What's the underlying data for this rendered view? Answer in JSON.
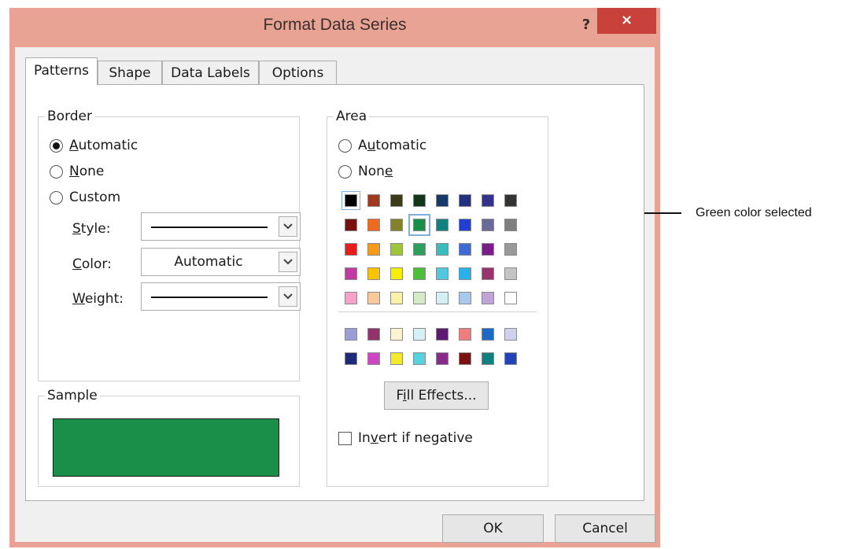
{
  "window": {
    "title": "Format Data Series",
    "help_label": "?",
    "close_label": "×"
  },
  "tabs": [
    {
      "label": "Patterns",
      "active": true
    },
    {
      "label": "Shape",
      "active": false
    },
    {
      "label": "Data Labels",
      "active": false
    },
    {
      "label": "Options",
      "active": false
    }
  ],
  "border": {
    "label": "Border",
    "options": [
      {
        "label": "Automatic",
        "accel_index": 0,
        "checked": true
      },
      {
        "label": "None",
        "accel_index": 0,
        "checked": false
      },
      {
        "label": "Custom",
        "accel_index": -1,
        "checked": false
      }
    ],
    "style_label": "Style:",
    "color_label": "Color:",
    "color_value": "Automatic",
    "weight_label": "Weight:"
  },
  "sample": {
    "label": "Sample",
    "color": "#1a8f4a"
  },
  "area": {
    "label": "Area",
    "options": [
      {
        "label": "Automatic",
        "accel_index": 1,
        "checked": false
      },
      {
        "label": "None",
        "accel_index": 3,
        "checked": false
      }
    ],
    "selected_color": "#1a8f4a",
    "palette_main": [
      [
        "#000000",
        "#a0391f",
        "#3b3b16",
        "#14371b",
        "#163a6a",
        "#23317f",
        "#33338f",
        "#333333"
      ],
      [
        "#7a1010",
        "#ef6a1c",
        "#838329",
        "#1a8f4a",
        "#108080",
        "#2140d0",
        "#6a6a9a",
        "#7f7f7f"
      ],
      [
        "#e81c1c",
        "#f69a1a",
        "#9fc53a",
        "#2e9e5d",
        "#3bbcbc",
        "#3f6ad3",
        "#7a1c8a",
        "#999999"
      ],
      [
        "#c13aa0",
        "#f9c300",
        "#f4f000",
        "#4cbf3a",
        "#51c8db",
        "#29b2e8",
        "#9b3270",
        "#c4c4c4"
      ],
      [
        "#f5a3c8",
        "#f9c89b",
        "#f9f2a8",
        "#d5ebc8",
        "#d4f0f4",
        "#a7c9ee",
        "#c2a3d8",
        "#ffffff"
      ]
    ],
    "palette_extra": [
      [
        "#9b9bd6",
        "#93336b",
        "#fbf5cf",
        "#d6f0f7",
        "#5e1a72",
        "#ef7d7d",
        "#1c6ac8",
        "#cfd0ee"
      ],
      [
        "#1f2a7c",
        "#cf46c4",
        "#f4e92a",
        "#58d2dc",
        "#8a2a8a",
        "#7a1212",
        "#108080",
        "#2344b8"
      ]
    ],
    "fill_effects_label": "Fill Effects...",
    "invert_label": "Invert if negative"
  },
  "buttons": {
    "ok_label": "OK",
    "cancel_label": "Cancel"
  },
  "annotation": {
    "text": "Green color selected"
  }
}
